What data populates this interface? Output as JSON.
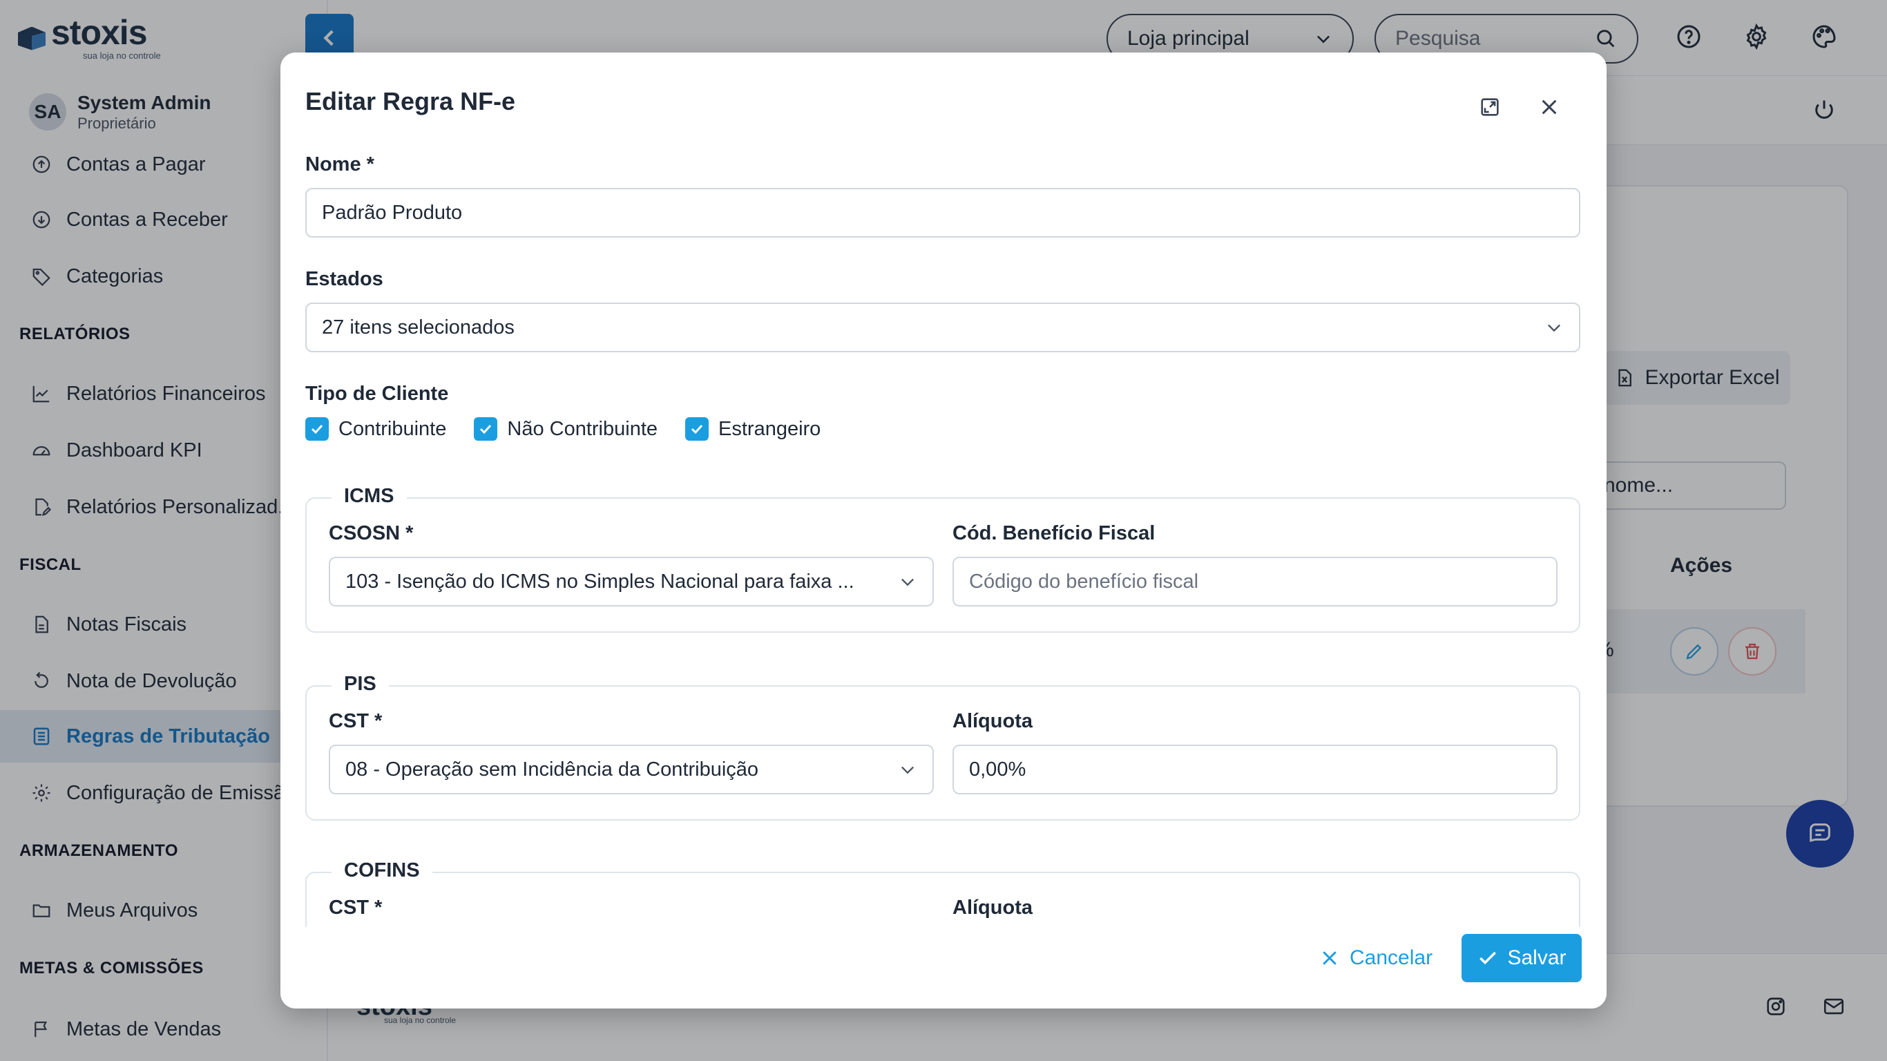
{
  "app": {
    "logo_text": "stoxis",
    "logo_tagline": "sua loja no controle",
    "user": {
      "initials": "SA",
      "name": "System Admin",
      "role": "Proprietário"
    }
  },
  "sidebar": {
    "items_top": [
      {
        "label": "Contas a Pagar",
        "icon": "arrow-up-circle-icon"
      },
      {
        "label": "Contas a Receber",
        "icon": "arrow-down-circle-icon"
      },
      {
        "label": "Categorias",
        "icon": "tag-icon"
      }
    ],
    "sections": [
      {
        "title": "RELATÓRIOS",
        "items": [
          {
            "label": "Relatórios Financeiros",
            "icon": "chart-icon"
          },
          {
            "label": "Dashboard KPI",
            "icon": "gauge-icon"
          },
          {
            "label": "Relatórios Personalizad..",
            "icon": "file-edit-icon"
          }
        ]
      },
      {
        "title": "FISCAL",
        "items": [
          {
            "label": "Notas Fiscais",
            "icon": "document-icon"
          },
          {
            "label": "Nota de Devolução",
            "icon": "undo-icon"
          },
          {
            "label": "Regras de Tributação",
            "icon": "list-icon",
            "active": true
          },
          {
            "label": "Configuração de Emissã",
            "icon": "gear-icon"
          }
        ]
      },
      {
        "title": "ARMAZENAMENTO",
        "items": [
          {
            "label": "Meus Arquivos",
            "icon": "folder-icon"
          }
        ]
      },
      {
        "title": "METAS & COMISSÕES",
        "items": [
          {
            "label": "Metas de Vendas",
            "icon": "flag-icon"
          }
        ]
      }
    ]
  },
  "topbar": {
    "store_select": "Loja principal",
    "search_placeholder": "Pesquisa"
  },
  "background": {
    "export_label": "Exportar Excel",
    "filter_value": "nome...",
    "actions_header": "Ações",
    "row_fragment": "%"
  },
  "modal": {
    "title": "Editar Regra NF-e",
    "name_label": "Nome *",
    "name_value": "Padrão Produto",
    "states_label": "Estados",
    "states_value": "27 itens selecionados",
    "client_type_label": "Tipo de Cliente",
    "client_types": [
      "Contribuinte",
      "Não Contribuinte",
      "Estrangeiro"
    ],
    "icms": {
      "legend": "ICMS",
      "csosn_label": "CSOSN *",
      "csosn_value": "103 - Isenção do ICMS no Simples Nacional para faixa ...",
      "benefit_label": "Cód. Benefício Fiscal",
      "benefit_placeholder": "Código do benefício fiscal"
    },
    "pis": {
      "legend": "PIS",
      "cst_label": "CST *",
      "cst_value": "08 - Operação sem Incidência da Contribuição",
      "rate_label": "Alíquota",
      "rate_value": "0,00%"
    },
    "cofins": {
      "legend": "COFINS",
      "cst_label": "CST *",
      "rate_label": "Alíquota"
    },
    "cancel_label": "Cancelar",
    "save_label": "Salvar"
  },
  "colors": {
    "accent": "#1b9ee0",
    "brand": "#1677c8",
    "active_nav": "#1578c4",
    "fab": "#1b3fa8",
    "delete": "#e05252"
  }
}
